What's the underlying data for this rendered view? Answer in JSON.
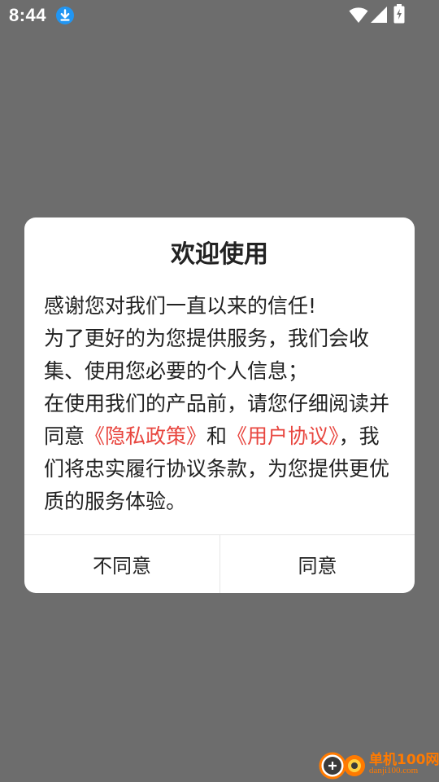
{
  "status_bar": {
    "time": "8:44",
    "icons": [
      "download-icon",
      "wifi-icon",
      "signal-icon",
      "battery-icon"
    ]
  },
  "dialog": {
    "title": "欢迎使用",
    "line1": "感谢您对我们一直以来的信任!",
    "line2": "为了更好的为您提供服务，我们会收集、使用您必要的个人信息；",
    "line3_prefix": "在使用我们的产品前，请您仔细阅读并同意",
    "privacy_link": "《隐私政策》",
    "conjunction": "和",
    "agreement_link": "《用户协议》",
    "line3_suffix": "，我们将忠实履行协议条款，为您提供更优质的服务体验。",
    "disagree_label": "不同意",
    "agree_label": "同意"
  },
  "watermark": {
    "name": "单机100网",
    "url": "danji100.com"
  },
  "colors": {
    "overlay": "#6d6d6d",
    "link": "#e8463f",
    "download_badge": "#2196f3",
    "watermark": "#ff7a00"
  }
}
